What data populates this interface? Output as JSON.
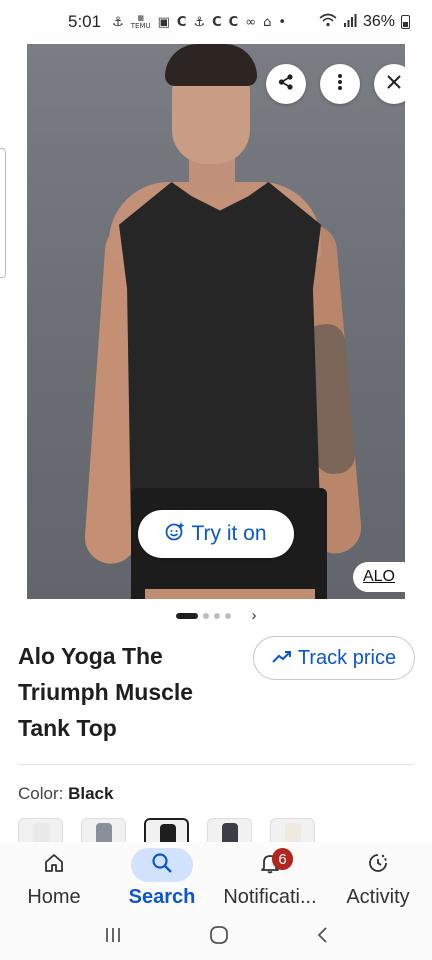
{
  "status_bar": {
    "time": "5:01",
    "icons": [
      "notif-icon",
      "temu-icon",
      "instagram-icon",
      "c-icon",
      "notif-icon",
      "c-icon",
      "c-icon",
      "voicemail-icon",
      "home-icon",
      "dot-icon"
    ],
    "temu_text": "TEMU",
    "battery": "36%"
  },
  "product_image": {
    "try_on_label": "Try it on",
    "brand_tag": "ALO",
    "pager": {
      "count": 4,
      "active_index": 0
    }
  },
  "product": {
    "title": "Alo Yoga The Triumph Muscle Tank Top",
    "track_price_label": "Track price",
    "color_label": "Color:",
    "color_value": "Black",
    "swatch_colors": [
      "#e9e9e9",
      "#8a9099",
      "#1e1e1e",
      "#3a3f47",
      "#efe9e2"
    ],
    "selected_swatch": 2
  },
  "bottom_nav": {
    "items": [
      {
        "label": "Home",
        "icon": "home-icon"
      },
      {
        "label": "Search",
        "icon": "search-icon"
      },
      {
        "label": "Notificati...",
        "icon": "bell-icon",
        "badge": "6"
      },
      {
        "label": "Activity",
        "icon": "activity-icon"
      }
    ],
    "active_index": 1
  },
  "colors": {
    "accent": "#0b57d0",
    "active_pill": "#d3e3fd",
    "badge": "#b3261e"
  }
}
